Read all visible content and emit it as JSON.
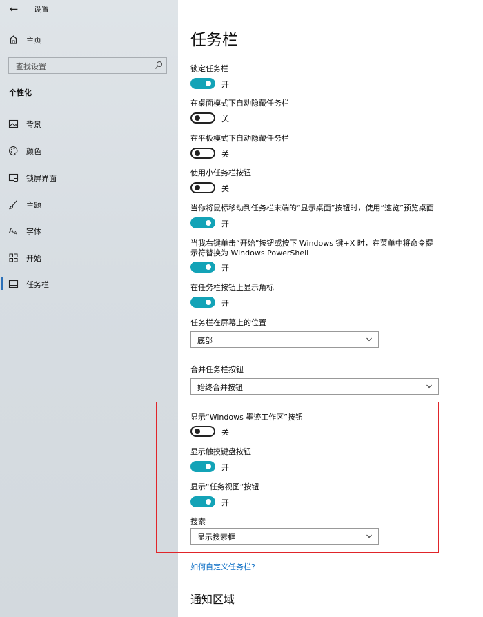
{
  "window": {
    "title": "设置"
  },
  "sidebar": {
    "home_label": "主页",
    "search_placeholder": "查找设置",
    "section": "个性化",
    "items": [
      {
        "label": "背景",
        "icon": "image-icon"
      },
      {
        "label": "颜色",
        "icon": "palette-icon"
      },
      {
        "label": "锁屏界面",
        "icon": "lock-screen-icon"
      },
      {
        "label": "主题",
        "icon": "brush-icon"
      },
      {
        "label": "字体",
        "icon": "font-icon"
      },
      {
        "label": "开始",
        "icon": "start-grid-icon"
      },
      {
        "label": "任务栏",
        "icon": "taskbar-icon",
        "selected": true
      }
    ]
  },
  "main": {
    "title": "任务栏",
    "settings": [
      {
        "label": "锁定任务栏",
        "state": "开",
        "on": true
      },
      {
        "label": "在桌面模式下自动隐藏任务栏",
        "state": "关",
        "on": false
      },
      {
        "label": "在平板模式下自动隐藏任务栏",
        "state": "关",
        "on": false
      },
      {
        "label": "使用小任务栏按钮",
        "state": "关",
        "on": false
      },
      {
        "label": "当你将鼠标移动到任务栏末端的“显示桌面”按钮时，使用“速览”预览桌面",
        "state": "开",
        "on": true
      },
      {
        "label": "当我右键单击“开始”按钮或按下 Windows 键+X 时，在菜单中将命令提",
        "label_line2": "示符替换为 Windows PowerShell",
        "state": "开",
        "on": true
      },
      {
        "label": "在任务栏按钮上显示角标",
        "state": "开",
        "on": true
      }
    ],
    "position": {
      "label": "任务栏在屏幕上的位置",
      "value": "底部"
    },
    "combine": {
      "label": "合并任务栏按钮",
      "value": "始终合并按钮"
    },
    "highlighted": [
      {
        "label": "显示“Windows 墨迹工作区”按钮",
        "state": "关",
        "on": false
      },
      {
        "label": "显示触摸键盘按钮",
        "state": "开",
        "on": true
      },
      {
        "label": "显示“任务视图”按钮",
        "state": "开",
        "on": true
      }
    ],
    "search": {
      "label": "搜索",
      "value": "显示搜索框"
    },
    "help_link": "如何自定义任务栏?",
    "notification_title": "通知区域"
  },
  "colors": {
    "accent": "#13a3b7",
    "link": "#0f70c6",
    "highlight_border": "#e0252a"
  }
}
